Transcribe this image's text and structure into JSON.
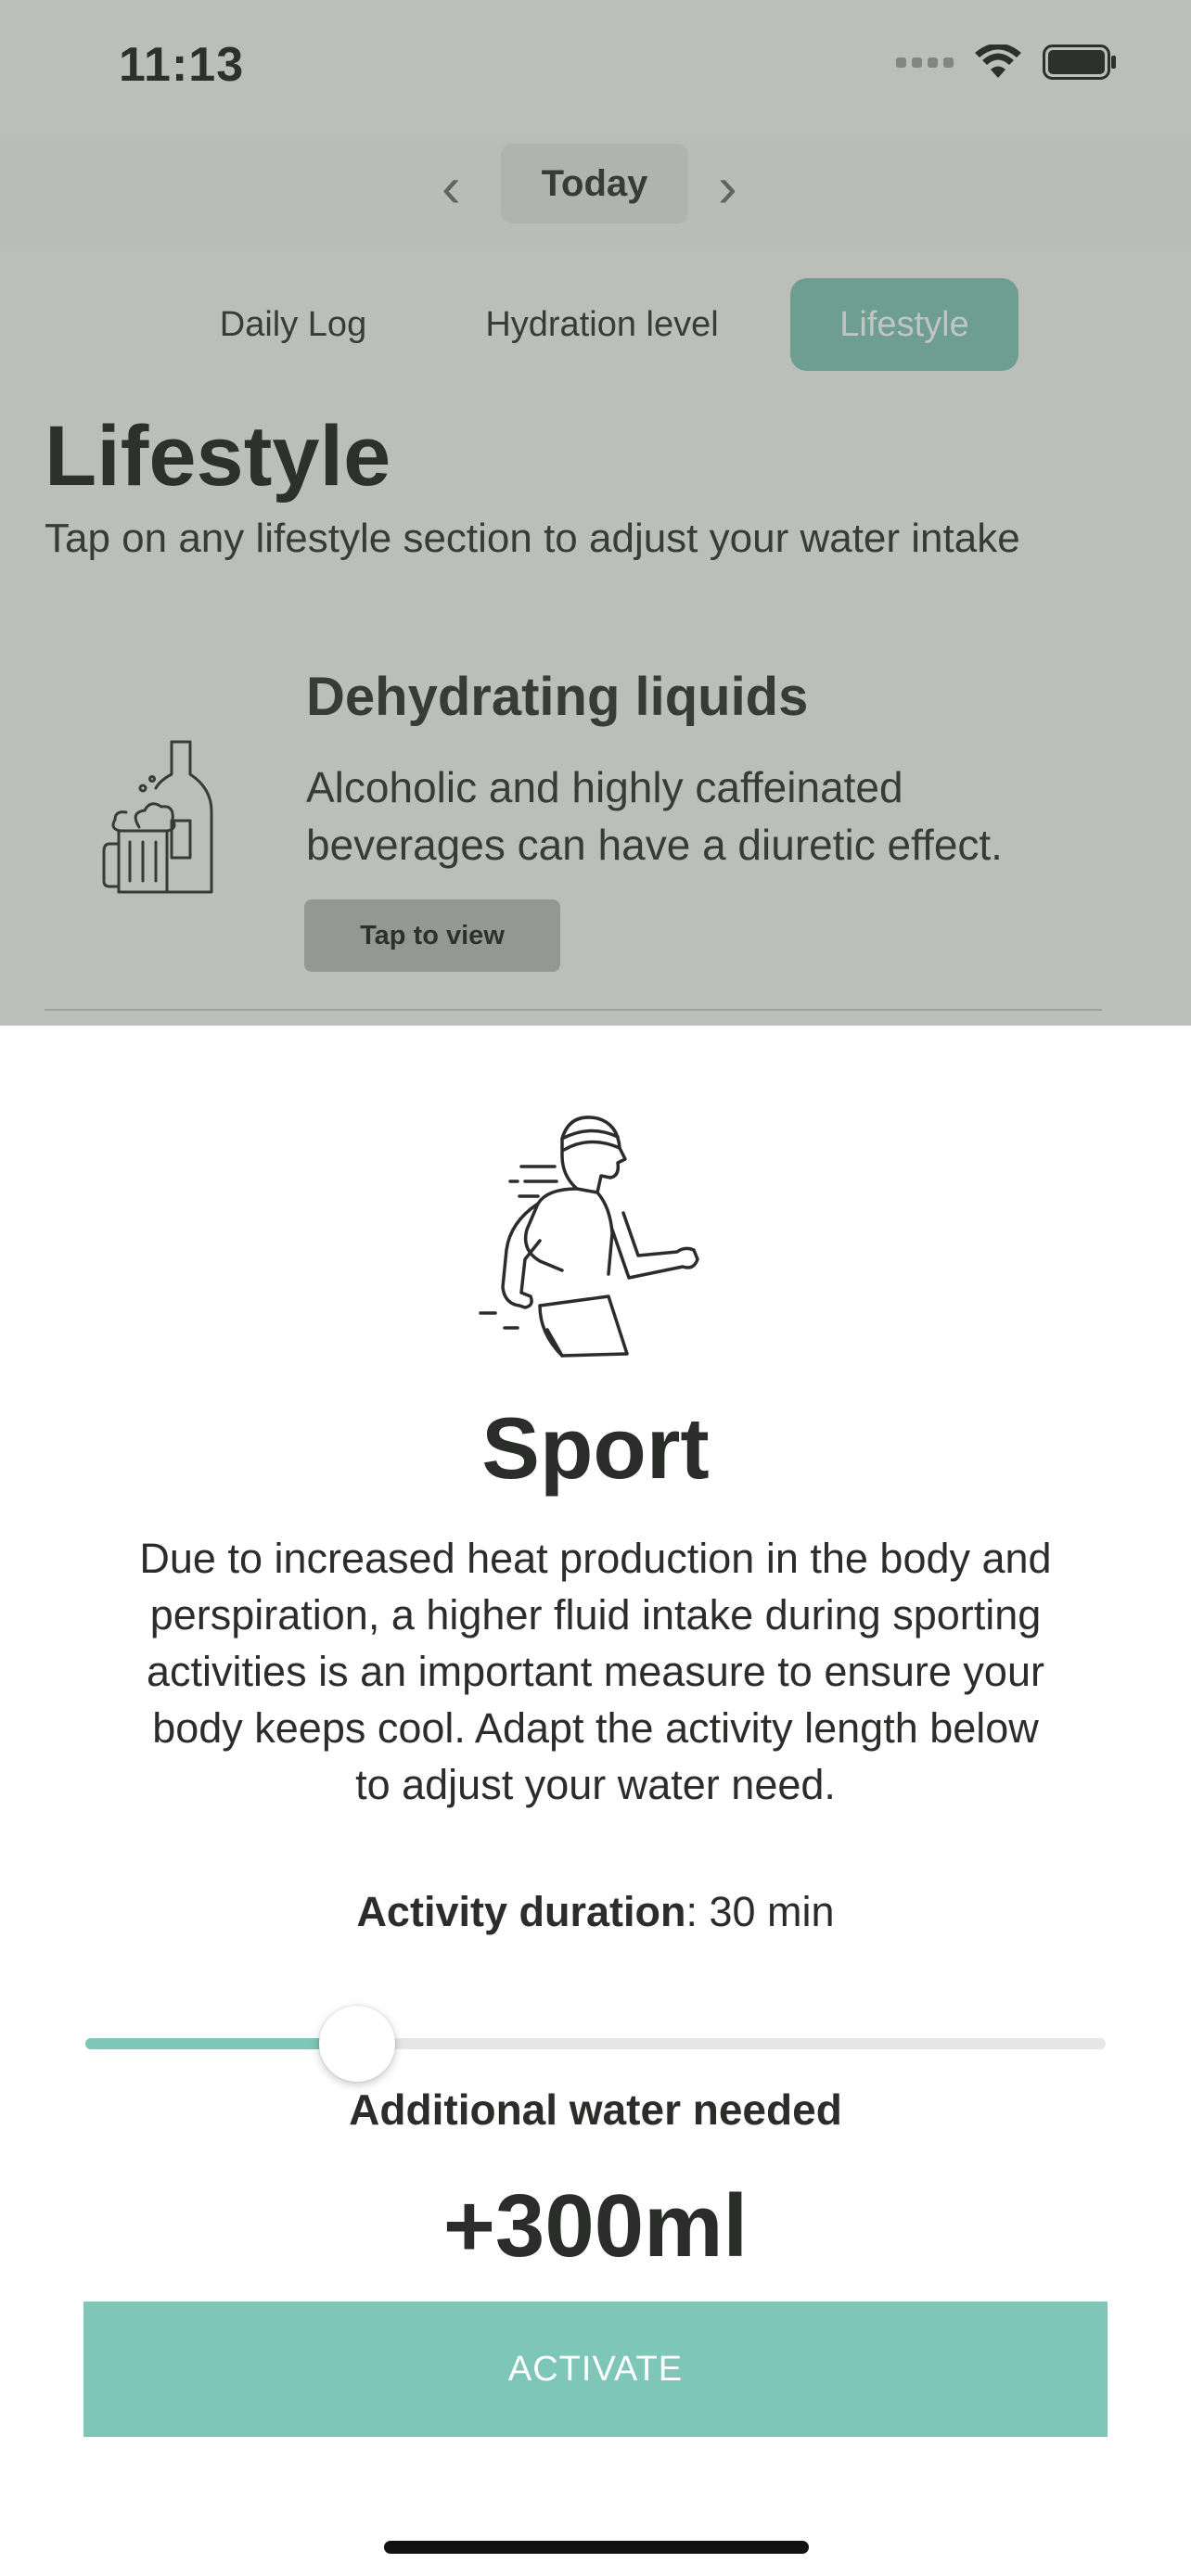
{
  "status_bar": {
    "time": "11:13"
  },
  "date_nav": {
    "prev": "‹",
    "label": "Today",
    "next": "›"
  },
  "tabs": [
    {
      "label": "Daily Log",
      "active": false
    },
    {
      "label": "Hydration level",
      "active": false
    },
    {
      "label": "Lifestyle",
      "active": true
    }
  ],
  "page": {
    "title": "Lifestyle",
    "subtitle": "Tap on any lifestyle section to adjust your water intake"
  },
  "card": {
    "icon": "beer-bottle-icon",
    "title": "Dehydrating liquids",
    "description": "Alcoholic and highly caffeinated beverages can have a diuretic effect.",
    "button": "Tap to view"
  },
  "sheet": {
    "icon": "runner-icon",
    "title": "Sport",
    "description": "Due to increased heat production in the body and perspiration, a higher fluid intake during sporting activities is an important measure to ensure your body keeps cool. Adapt the activity length below to adjust your water need.",
    "duration_label": "Activity duration",
    "duration_value": ": 30 min",
    "slider_fraction": 0.266,
    "water_label": "Additional water needed",
    "water_amount": "+300ml",
    "activate": "ACTIVATE"
  },
  "colors": {
    "accent": "#7ec6b7",
    "tab_active": "#77c2b2",
    "text": "#2b2d2b"
  }
}
